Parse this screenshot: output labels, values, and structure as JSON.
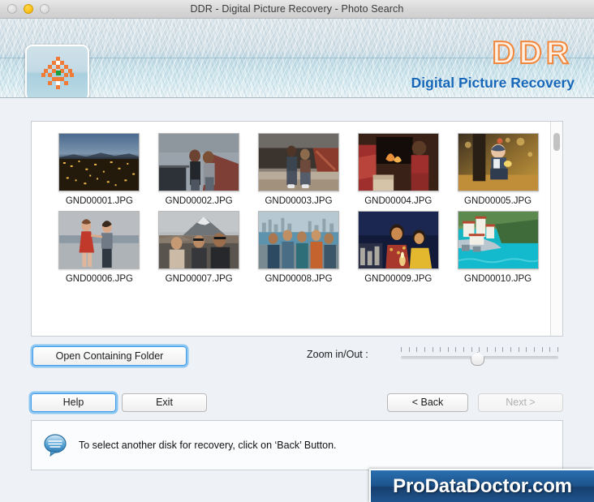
{
  "window": {
    "title": "DDR - Digital Picture Recovery - Photo Search",
    "traffic_lights": [
      {
        "name": "close",
        "state": "inactive"
      },
      {
        "name": "minimize",
        "state": "active-yellow"
      },
      {
        "name": "zoom",
        "state": "inactive"
      }
    ]
  },
  "header": {
    "logo_icon": "checkered-flower-logo-icon",
    "brand": "DDR",
    "brand_subtitle": "Digital Picture Recovery",
    "brand_color": "#f2873c",
    "subtitle_color": "#1667b8"
  },
  "grid": {
    "rows": [
      [
        {
          "filename": "GND00001.JPG",
          "scene": "city-lights-at-dusk"
        },
        {
          "filename": "GND00002.JPG",
          "scene": "two-women-on-street"
        },
        {
          "filename": "GND00003.JPG",
          "scene": "couple-sitting-on-steps"
        },
        {
          "filename": "GND00004.JPG",
          "scene": "child-by-fireplace"
        },
        {
          "filename": "GND00005.JPG",
          "scene": "toddler-in-autumn-leaves"
        }
      ],
      [
        {
          "filename": "GND00006.JPG",
          "scene": "two-women-by-lake"
        },
        {
          "filename": "GND00007.JPG",
          "scene": "three-men-near-volcano"
        },
        {
          "filename": "GND00008.JPG",
          "scene": "group-of-friends-by-bay"
        },
        {
          "filename": "GND00009.JPG",
          "scene": "children-with-candles-at-night"
        },
        {
          "filename": "GND00010.JPG",
          "scene": "coastal-town-turquoise-sea"
        }
      ]
    ],
    "scrollbar_position_percent": 5
  },
  "controls": {
    "open_folder_label": "Open Containing Folder",
    "zoom_label": "Zoom in/Out :",
    "zoom_slider": {
      "tick_count": 21,
      "value_percent": 48
    }
  },
  "actions": {
    "help_label": "Help",
    "exit_label": "Exit",
    "back_label": "< Back",
    "next_label": "Next >",
    "help_focused": true,
    "next_disabled": true
  },
  "status": {
    "icon": "speech-bubble-icon",
    "message": "To select another disk for recovery, click on ‘Back’ Button."
  },
  "watermark": {
    "text": "ProDataDoctor.com"
  }
}
